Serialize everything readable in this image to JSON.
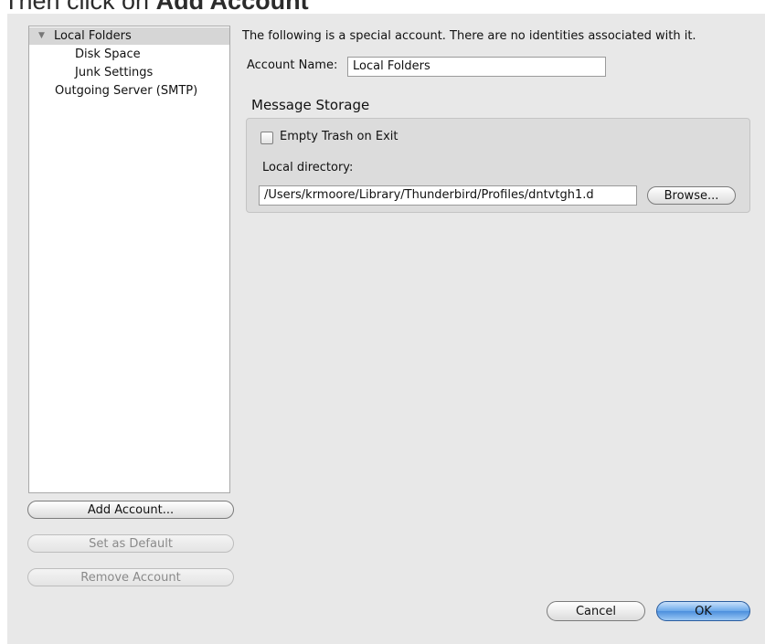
{
  "caption": {
    "prefix": "Then click on ",
    "emphasis": "Add Account"
  },
  "sidebar": {
    "items": [
      {
        "label": "Local Folders"
      },
      {
        "label": "Disk Space"
      },
      {
        "label": "Junk Settings"
      },
      {
        "label": "Outgoing Server (SMTP)"
      }
    ],
    "buttons": {
      "add_account": "Add Account...",
      "set_default": "Set as Default",
      "remove_account": "Remove Account"
    }
  },
  "main": {
    "description": "The following is a special account. There are no identities associated with it.",
    "account_name_label": "Account Name:",
    "account_name_value": "Local Folders",
    "storage_heading": "Message Storage",
    "empty_trash_label": "Empty Trash on Exit",
    "empty_trash_checked": false,
    "local_directory_label": "Local directory:",
    "local_directory_value": "/Users/krmoore/Library/Thunderbird/Profiles/dntvtgh1.d",
    "browse_label": "Browse..."
  },
  "footer": {
    "cancel_label": "Cancel",
    "ok_label": "OK"
  },
  "colors": {
    "panel_bg": "#e8e8e8",
    "selection_bg": "#d6d6d6",
    "ok_button": "#4b8fdd"
  }
}
